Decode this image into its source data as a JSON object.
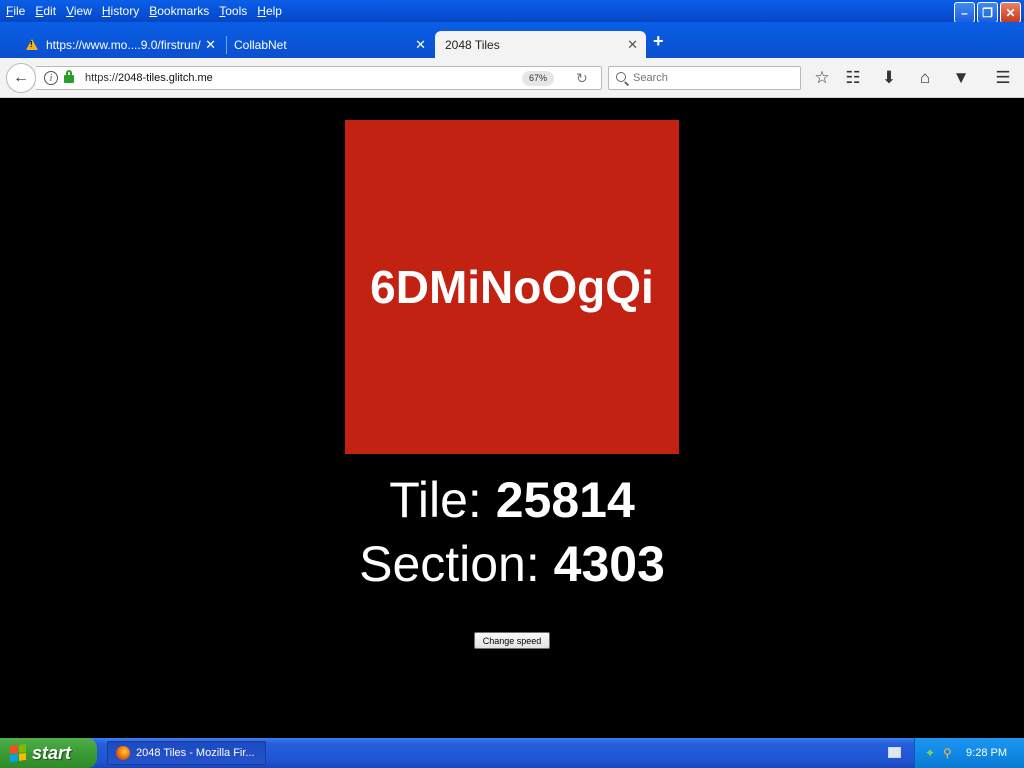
{
  "menubar": {
    "items": [
      {
        "label": "File",
        "key": "F",
        "rest": "ile"
      },
      {
        "label": "Edit",
        "key": "E",
        "rest": "dit"
      },
      {
        "label": "View",
        "key": "V",
        "rest": "iew"
      },
      {
        "label": "History",
        "key": "H",
        "rest": "istory"
      },
      {
        "label": "Bookmarks",
        "key": "B",
        "rest": "ookmarks"
      },
      {
        "label": "Tools",
        "key": "T",
        "rest": "ools"
      },
      {
        "label": "Help",
        "key": "H",
        "rest": "elp"
      }
    ]
  },
  "tabs": [
    {
      "title": "https://www.mo....9.0/firstrun/",
      "icon": "warning-icon",
      "active": false
    },
    {
      "title": "CollabNet",
      "icon": "",
      "active": false
    },
    {
      "title": "2048 Tiles",
      "icon": "",
      "active": true
    }
  ],
  "navbar": {
    "url_prefix": "https://",
    "url_host": "2048-tiles.glitch.me",
    "zoom": "67%",
    "search_placeholder": "Search"
  },
  "page": {
    "tile_code": "6DMiNoOgQi",
    "tile_label": "Tile: ",
    "tile_number": "25814",
    "section_label": "Section: ",
    "section_number": "4303",
    "change_speed_label": "Change speed"
  },
  "taskbar": {
    "start_label": "start",
    "task_title": "2048 Tiles - Mozilla Fir...",
    "clock": "9:28 PM"
  },
  "colors": {
    "tile_background": "#c22212",
    "page_background": "#000000",
    "titlebar_blue": "#0650d6"
  }
}
